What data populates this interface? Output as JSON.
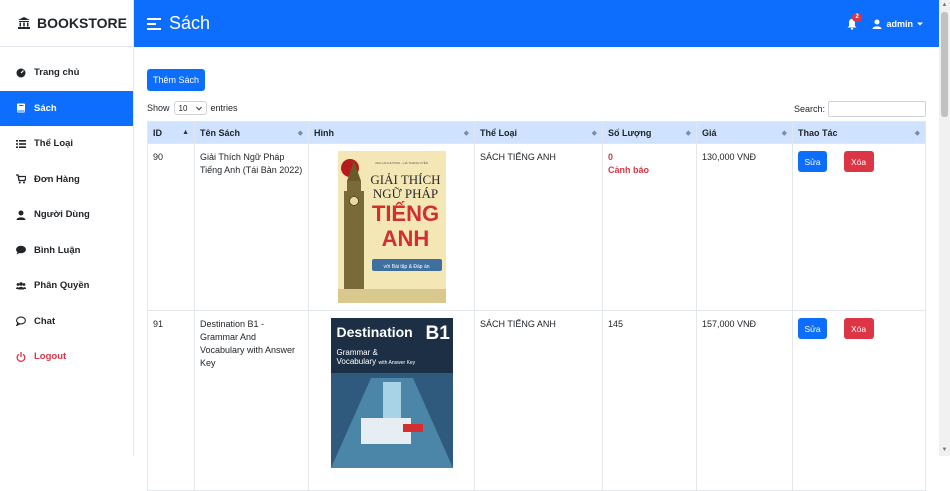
{
  "brand": {
    "name": "BOOKSTORE"
  },
  "sidebar": {
    "items": [
      {
        "label": "Trang chủ",
        "icon": "dashboard-icon",
        "active": false
      },
      {
        "label": "Sách",
        "icon": "book-icon",
        "active": true
      },
      {
        "label": "Thể Loại",
        "icon": "list-icon",
        "active": false
      },
      {
        "label": "Đơn Hàng",
        "icon": "cart-icon",
        "active": false
      },
      {
        "label": "Người Dùng",
        "icon": "user-icon",
        "active": false
      },
      {
        "label": "Bình Luận",
        "icon": "comment-icon",
        "active": false
      },
      {
        "label": "Phân Quyền",
        "icon": "users-icon",
        "active": false
      },
      {
        "label": "Chat",
        "icon": "chat-icon",
        "active": false
      },
      {
        "label": "Logout",
        "icon": "power-icon",
        "active": false
      }
    ]
  },
  "header": {
    "title": "Sách",
    "notification_count": "2",
    "user": "admin"
  },
  "toolbar": {
    "add_label": "Thêm Sách"
  },
  "table_controls": {
    "show_label": "Show",
    "page_size": "10",
    "entries_label": "entries",
    "search_label": "Search:",
    "search_value": ""
  },
  "table": {
    "columns": [
      "ID",
      "Tên Sách",
      "Hình",
      "Thể Loại",
      "Số Lượng",
      "Giá",
      "Thao Tác"
    ],
    "rows": [
      {
        "id": "90",
        "name": "Giải Thích Ngữ Pháp Tiếng Anh (Tái Bản 2022)",
        "cover": {
          "authors": "MAI LAN HƯƠNG – HÀ THANH UYÊN",
          "line1": "GIẢI THÍCH",
          "line2": "NGỮ PHÁP",
          "line3": "TIẾNG",
          "line4": "ANH",
          "subtitle": "với Bài tập & Đáp án"
        },
        "category": "SÁCH TIẾNG ANH",
        "quantity": "0",
        "warning": "Cảnh báo",
        "price": "130,000 VNĐ",
        "edit_label": "Sửa",
        "delete_label": "Xóa"
      },
      {
        "id": "91",
        "name": "Destination B1 - Grammar And Vocabulary with Answer Key",
        "cover": {
          "line1": "Destination",
          "level": "B1",
          "line2": "Grammar &",
          "line3": "Vocabulary",
          "line4": "with Answer Key"
        },
        "category": "SÁCH TIẾNG ANH",
        "quantity": "145",
        "warning": "",
        "price": "157,000 VNĐ",
        "edit_label": "Sửa",
        "delete_label": "Xóa"
      }
    ]
  },
  "colors": {
    "primary": "#0d6efd",
    "danger": "#dc3545",
    "header_row": "#cfe2ff"
  }
}
